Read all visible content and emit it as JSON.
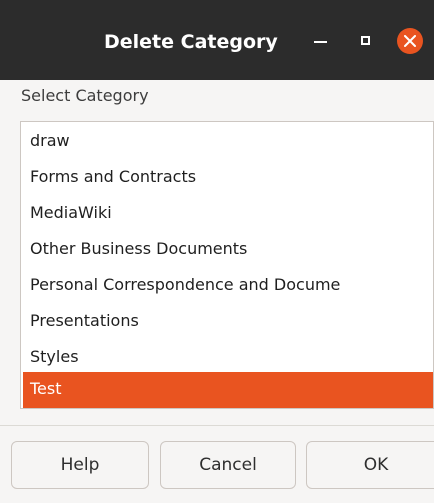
{
  "window": {
    "title": "Delete Category"
  },
  "dialog": {
    "label": "Select Category",
    "items": [
      {
        "label": "draw",
        "selected": false
      },
      {
        "label": "Forms and Contracts",
        "selected": false
      },
      {
        "label": "MediaWiki",
        "selected": false
      },
      {
        "label": "Other Business Documents",
        "selected": false
      },
      {
        "label": "Personal Correspondence and Docume",
        "selected": false
      },
      {
        "label": "Presentations",
        "selected": false
      },
      {
        "label": "Styles",
        "selected": false
      },
      {
        "label": "Test",
        "selected": true
      }
    ],
    "buttons": {
      "help": "Help",
      "cancel": "Cancel",
      "ok": "OK"
    }
  },
  "icons": {
    "minimize": "minimize-icon",
    "maximize": "maximize-icon",
    "close": "close-icon"
  },
  "colors": {
    "titlebar": "#2c2c2c",
    "accent": "#e95420",
    "window_bg": "#f6f5f4"
  }
}
